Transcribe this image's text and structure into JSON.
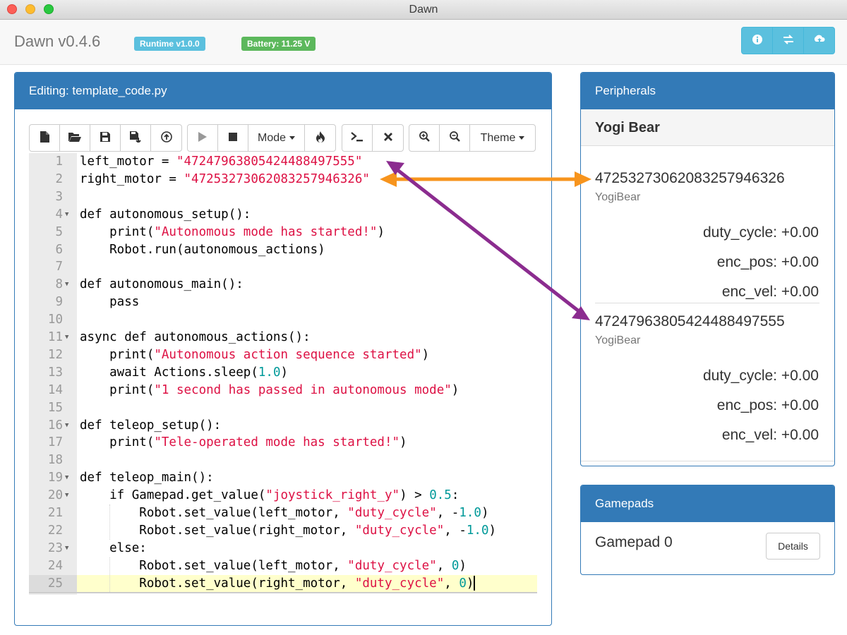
{
  "window": {
    "title": "Dawn"
  },
  "header": {
    "brand": "Dawn v0.4.6",
    "runtime_badge": "Runtime v1.0.0",
    "battery_badge": "Battery: 11.25 V",
    "buttons": [
      {
        "icon": "info-icon"
      },
      {
        "icon": "transfer-icon"
      },
      {
        "icon": "upload-icon"
      }
    ]
  },
  "editor": {
    "title": "Editing: template_code.py",
    "toolbar": {
      "file_buttons": [
        "new-file-icon",
        "open-folder-icon",
        "save-icon",
        "save-as-icon",
        "upload-code-icon"
      ],
      "run_buttons": [
        "play-icon",
        "stop-icon"
      ],
      "mode_label": "Mode",
      "fire_icon": "estop-icon",
      "console_buttons": [
        "console-icon",
        "clear-icon"
      ],
      "zoom_buttons": [
        "zoom-in-icon",
        "zoom-out-icon"
      ],
      "theme_label": "Theme"
    },
    "lines": [
      "left_motor = \"47247963805424488497555\"",
      "right_motor = \"47253273062083257946326\"",
      "",
      "def autonomous_setup():",
      "    print(\"Autonomous mode has started!\")",
      "    Robot.run(autonomous_actions)",
      "",
      "def autonomous_main():",
      "    pass",
      "",
      "async def autonomous_actions():",
      "    print(\"Autonomous action sequence started\")",
      "    await Actions.sleep(1.0)",
      "    print(\"1 second has passed in autonomous mode\")",
      "",
      "def teleop_setup():",
      "    print(\"Tele-operated mode has started!\")",
      "",
      "def teleop_main():",
      "    if Gamepad.get_value(\"joystick_right_y\") > 0.5:",
      "        Robot.set_value(left_motor, \"duty_cycle\", -1.0)",
      "        Robot.set_value(right_motor, \"duty_cycle\", -1.0)",
      "    else:",
      "        Robot.set_value(left_motor, \"duty_cycle\", 0)",
      "        Robot.set_value(right_motor, \"duty_cycle\", 0)"
    ],
    "fold_lines": [
      4,
      8,
      11,
      16,
      19,
      20,
      23
    ],
    "active_line": 25
  },
  "peripherals": {
    "title": "Peripherals",
    "group": "Yogi Bear",
    "devices": [
      {
        "id": "47253273062083257946326",
        "type": "YogiBear",
        "params": [
          "duty_cycle: +0.00",
          "enc_pos: +0.00",
          "enc_vel: +0.00"
        ]
      },
      {
        "id": "47247963805424488497555",
        "type": "YogiBear",
        "params": [
          "duty_cycle: +0.00",
          "enc_pos: +0.00",
          "enc_vel: +0.00"
        ]
      }
    ]
  },
  "gamepads": {
    "title": "Gamepads",
    "items": [
      {
        "name": "Gamepad 0",
        "button": "Details"
      }
    ]
  },
  "annotations": {
    "orange": "#f7941d",
    "purple": "#8b2c8f"
  }
}
